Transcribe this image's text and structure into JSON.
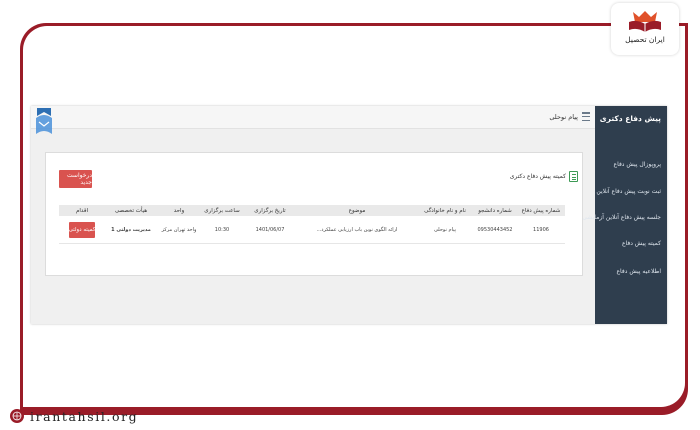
{
  "brand": {
    "logo_text": "ایران تحصیل",
    "site_url": "irantahsil.org"
  },
  "app": {
    "sidebar_title": "پیش دفاع دکتری",
    "menu_items": [
      "پروپوزال پیش دفاع",
      "ثبت نوبت پیش دفاع آنلاین",
      "جلسه پیش دفاع آنلاین آزمایشی",
      "کمیته پیش دفاع",
      "اطلاعیه پیش دفاع"
    ],
    "user_name": "پیام نوحلی"
  },
  "panel": {
    "title": "کمیته پیش دفاع دکتری",
    "new_button": "درخواست جدید",
    "columns": [
      "شماره پیش دفاع",
      "شماره دانشجو",
      "نام و نام خانوادگی",
      "موضوع",
      "تاریخ برگزاری",
      "ساعت برگزاری",
      "واحد",
      "هیأت تخصصی",
      "اقدام"
    ],
    "rows": [
      {
        "id": "11906",
        "student_no": "09530443452",
        "name": "پیام نوحلی",
        "subject": "ارائه الگوی نوین باب ارزیابی عملکرد...",
        "date": "1401/06/07",
        "time": "10:30",
        "unit": "واحد تهران مرکز",
        "committee": "مدیریت دولتی 1",
        "action": "کمیته دولتی"
      }
    ]
  }
}
